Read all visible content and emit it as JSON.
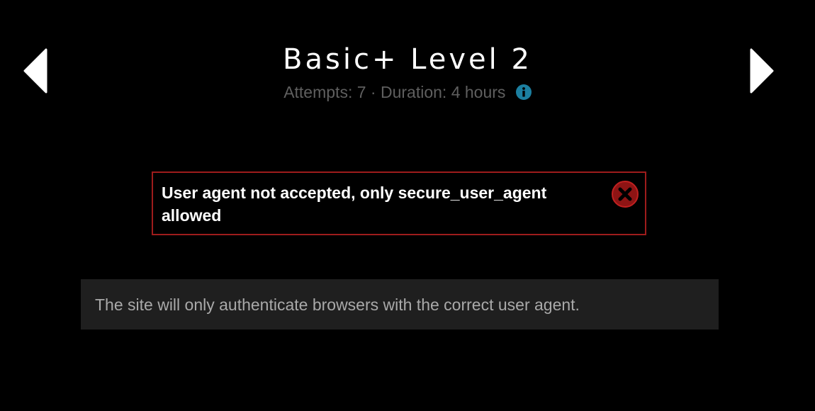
{
  "nav": {
    "prev_icon": "chevron-left-icon",
    "next_icon": "chevron-right-icon"
  },
  "header": {
    "title": "Basic+ Level 2",
    "attempts_label": "Attempts:",
    "attempts_value": "7",
    "separator": "·",
    "duration_label": "Duration:",
    "duration_value": "4 hours",
    "info_icon": "info-icon"
  },
  "alert": {
    "message": "User agent not accepted, only secure_user_agent allowed",
    "close_icon": "close-icon"
  },
  "hint": {
    "text": "The site will only authenticate browsers with the correct user agent."
  },
  "colors": {
    "background": "#000000",
    "title": "#ffffff",
    "meta": "#5f5f5f",
    "info_accent": "#1c7fa0",
    "alert_border": "#9e1c1c",
    "alert_icon": "#9e1c1c",
    "hint_background": "#1f1f1f",
    "hint_text": "#a9a9a9"
  }
}
